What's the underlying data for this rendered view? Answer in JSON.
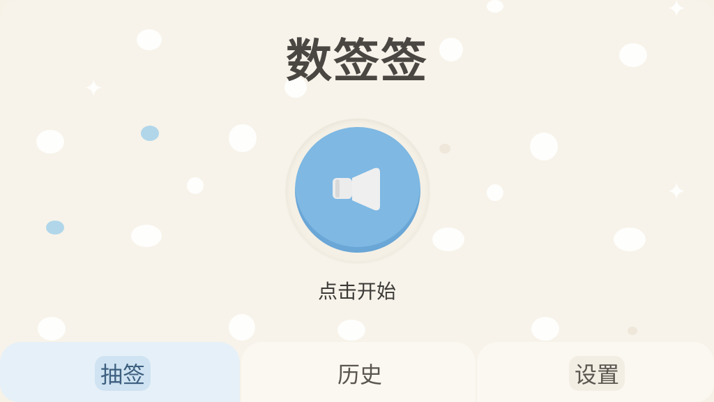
{
  "app": {
    "title": "数签签"
  },
  "main": {
    "start_button_icon": "megaphone-icon",
    "start_label": "点击开始"
  },
  "tabs": [
    {
      "label": "抽签",
      "active": true
    },
    {
      "label": "历史",
      "active": false
    },
    {
      "label": "设置",
      "active": false
    }
  ],
  "colors": {
    "background": "#f7f3ea",
    "accent_blue": "#7eb8e3",
    "title_text": "#4a4642",
    "active_tab": "#e6f0f8"
  }
}
